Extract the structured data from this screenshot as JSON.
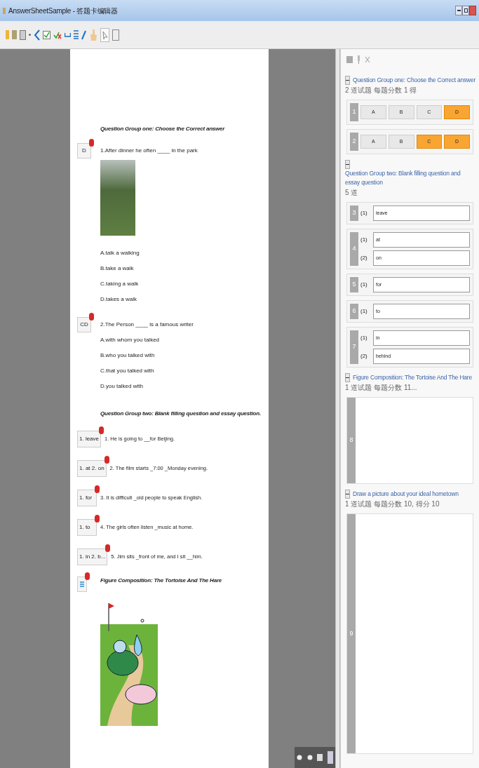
{
  "window": {
    "title": "AnswerSheetSample - 答题卡编辑器"
  },
  "document": {
    "sections": [
      {
        "kind": "heading",
        "text": "Question Group one: Choose the Correct answer"
      },
      {
        "kind": "choice",
        "answer": "D",
        "question": "1.After dinner he often ____ in the park",
        "photo": true,
        "options": [
          "A.talk a walking",
          "B.take a walk",
          "C.taking a walk",
          "D.takes a walk"
        ]
      },
      {
        "kind": "choice",
        "answer": "CD",
        "question": "2.The Person ____ is a famous writer",
        "photo": false,
        "options": [
          "A.with whom you talked",
          "B.who you talked with",
          "C.that you talked with",
          "D.you talked with"
        ]
      },
      {
        "kind": "heading",
        "text": "Question Group two: Blank filling question and essay question."
      },
      {
        "kind": "blank",
        "answer": "1. leave",
        "question": "1.  He is going to __for Beijing."
      },
      {
        "kind": "blank",
        "answer": "1. at 2. on",
        "question": "2.  The film starts  _7:00  _Monday evening."
      },
      {
        "kind": "blank",
        "answer": "1. for",
        "question": "3.  It is difficult _old people to speak English."
      },
      {
        "kind": "blank",
        "answer": "1. to",
        "question": "4.  The girls often listen  _music at home."
      },
      {
        "kind": "blank",
        "answer": "1. in 2. b...",
        "question": "5.  Jim sits  _front of me, and I sit  __him."
      },
      {
        "kind": "figure",
        "text": "Figure Composition: The Tortoise And The Hare"
      }
    ]
  },
  "panel": {
    "groups": [
      {
        "title": "Question Group one: Choose the Correct answer",
        "meta": "2 道试题 每题分数 1 得",
        "expanded": true,
        "items": [
          {
            "kind": "choice",
            "number": "1",
            "options": [
              {
                "label": "A",
                "selected": false
              },
              {
                "label": "B",
                "selected": false
              },
              {
                "label": "C",
                "selected": false
              },
              {
                "label": "D",
                "selected": true
              }
            ]
          },
          {
            "kind": "choice",
            "number": "2",
            "options": [
              {
                "label": "A",
                "selected": false
              },
              {
                "label": "B",
                "selected": false
              },
              {
                "label": "C",
                "selected": true
              },
              {
                "label": "D",
                "selected": true
              }
            ]
          }
        ]
      },
      {
        "title": "Question Group two: Blank filling question and essay question",
        "meta": "5 道",
        "expanded": true,
        "items": [
          {
            "kind": "blank",
            "number": "3",
            "blanks": [
              {
                "label": "(1)",
                "value": "leave"
              }
            ]
          },
          {
            "kind": "blank",
            "number": "4",
            "blanks": [
              {
                "label": "(1)",
                "value": "at"
              },
              {
                "label": "(2)",
                "value": "on"
              }
            ]
          },
          {
            "kind": "blank",
            "number": "5",
            "blanks": [
              {
                "label": "(1)",
                "value": "for"
              }
            ]
          },
          {
            "kind": "blank",
            "number": "6",
            "blanks": [
              {
                "label": "(1)",
                "value": "to"
              }
            ]
          },
          {
            "kind": "blank",
            "number": "7",
            "blanks": [
              {
                "label": "(1)",
                "value": "in"
              },
              {
                "label": "(2)",
                "value": "behind"
              }
            ]
          }
        ]
      },
      {
        "title": "Figure Composition: The Tortoise And The Hare",
        "meta": "1 道试题 每题分数 11...",
        "expanded": true,
        "items": [
          {
            "kind": "essay",
            "number": "8"
          }
        ]
      },
      {
        "title": "Draw a picture about your ideal hometown",
        "meta": "1 道试题 每题分数 10, 得分 10",
        "expanded": true,
        "items": [
          {
            "kind": "essay",
            "number": "9"
          }
        ]
      }
    ]
  }
}
